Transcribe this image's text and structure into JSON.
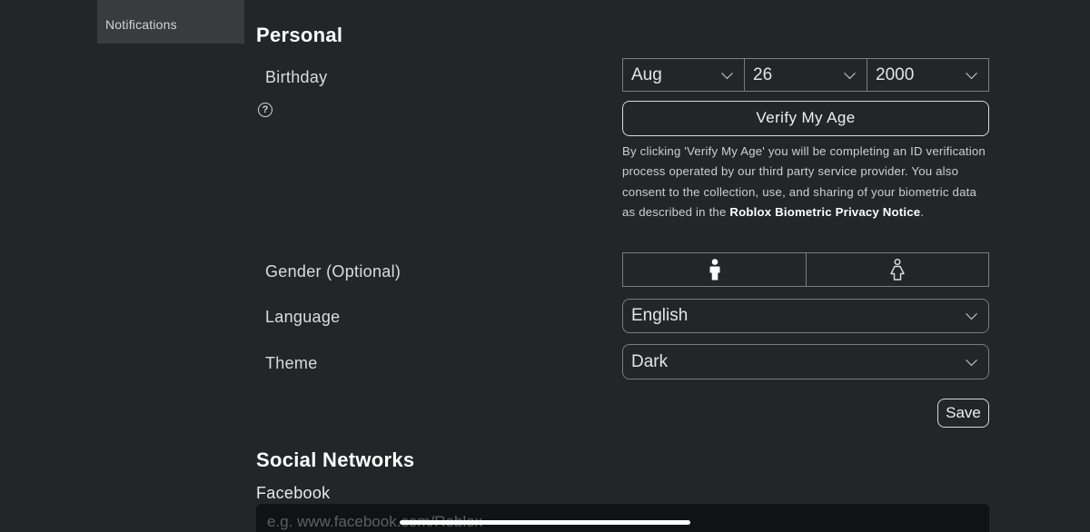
{
  "sidebar": {
    "items": [
      {
        "label": "Notifications"
      }
    ]
  },
  "personal": {
    "title": "Personal",
    "birthday": {
      "label": "Birthday",
      "month": "Aug",
      "day": "26",
      "year": "2000",
      "help_icon": "question-circle-icon"
    },
    "verify_button": "Verify My Age",
    "disclaimer": {
      "text": "By clicking 'Verify My Age' you will be completing an ID verification process operated by our third party service provider. You also consent to the collection, use, and sharing of your biometric data as described in the",
      "link": "Roblox Biometric Privacy Notice",
      "end": "."
    },
    "gender": {
      "label": "Gender (Optional)",
      "options": [
        {
          "icon": "male-person-icon",
          "selected": true
        },
        {
          "icon": "female-person-icon",
          "selected": false
        }
      ]
    },
    "language": {
      "label": "Language",
      "value": "English"
    },
    "theme": {
      "label": "Theme",
      "value": "Dark"
    },
    "save_button": "Save"
  },
  "social": {
    "title": "Social Networks",
    "facebook": {
      "label": "Facebook",
      "placeholder": "e.g. www.facebook.com/Roblox"
    }
  }
}
